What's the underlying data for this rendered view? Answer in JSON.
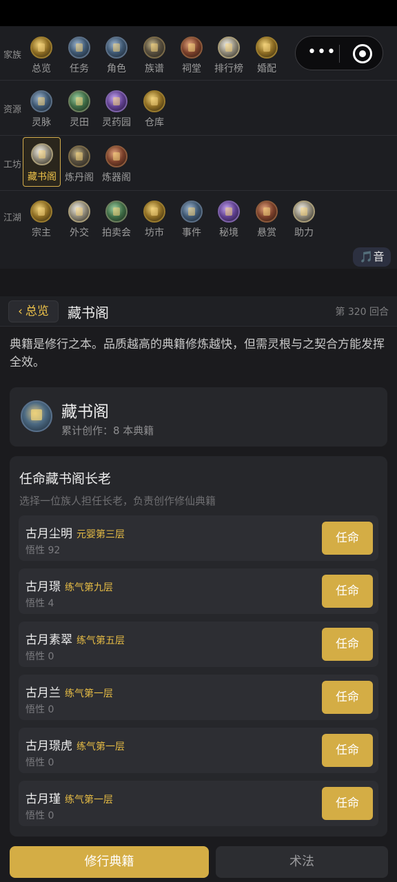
{
  "nav": {
    "rows": [
      {
        "label": "家族",
        "items": [
          {
            "label": "总览",
            "icon": "family-seal-icon"
          },
          {
            "label": "任务",
            "icon": "task-scroll-icon"
          },
          {
            "label": "角色",
            "icon": "character-icon"
          },
          {
            "label": "族谱",
            "icon": "genealogy-tree-icon"
          },
          {
            "label": "祠堂",
            "icon": "ancestral-hall-icon"
          },
          {
            "label": "排行榜",
            "icon": "ranking-icon"
          },
          {
            "label": "婚配",
            "icon": "marriage-icon"
          }
        ]
      },
      {
        "label": "资源",
        "items": [
          {
            "label": "灵脉",
            "icon": "spirit-vein-icon"
          },
          {
            "label": "灵田",
            "icon": "spirit-field-icon"
          },
          {
            "label": "灵药园",
            "icon": "herb-garden-icon"
          },
          {
            "label": "仓库",
            "icon": "warehouse-icon"
          }
        ]
      },
      {
        "label": "工坊",
        "items": [
          {
            "label": "藏书阁",
            "icon": "library-pavilion-icon",
            "active": true
          },
          {
            "label": "炼丹阁",
            "icon": "alchemy-furnace-icon"
          },
          {
            "label": "炼器阁",
            "icon": "forge-icon"
          }
        ]
      },
      {
        "label": "江湖",
        "items": [
          {
            "label": "宗主",
            "icon": "sect-master-icon"
          },
          {
            "label": "外交",
            "icon": "diplomacy-icon"
          },
          {
            "label": "拍卖会",
            "icon": "auction-icon"
          },
          {
            "label": "坊市",
            "icon": "market-icon"
          },
          {
            "label": "事件",
            "icon": "event-icon"
          },
          {
            "label": "秘境",
            "icon": "secret-realm-icon"
          },
          {
            "label": "悬赏",
            "icon": "bounty-icon"
          },
          {
            "label": "助力",
            "icon": "assist-icon"
          }
        ]
      }
    ]
  },
  "capsule": {
    "more": "•••"
  },
  "music": {
    "note": "🎵",
    "label": "音"
  },
  "topbar": {
    "back_label": "总览",
    "back_arrow": "‹",
    "title": "藏书阁",
    "round": "第 320 回合"
  },
  "intro": "典籍是修行之本。品质越高的典籍修炼越快，但需灵根与之契合方能发挥全效。",
  "library": {
    "name": "藏书阁",
    "stats": "累计创作：8 本典籍"
  },
  "appoint": {
    "heading": "任命藏书阁长老",
    "description": "选择一位族人担任长老，负责创作修仙典籍",
    "button_label": "任命",
    "candidates": [
      {
        "name": "古月尘明",
        "realm": "元婴第三层",
        "wuxing": "悟性 92"
      },
      {
        "name": "古月璟",
        "realm": "练气第九层",
        "wuxing": "悟性 4"
      },
      {
        "name": "古月素翠",
        "realm": "练气第五层",
        "wuxing": "悟性 0"
      },
      {
        "name": "古月兰",
        "realm": "练气第一层",
        "wuxing": "悟性 0"
      },
      {
        "name": "古月璟虎",
        "realm": "练气第一层",
        "wuxing": "悟性 0"
      },
      {
        "name": "古月瑾",
        "realm": "练气第一层",
        "wuxing": "悟性 0"
      }
    ]
  },
  "tabs": [
    {
      "label": "修行典籍",
      "active": true
    },
    {
      "label": "术法",
      "active": false
    }
  ]
}
